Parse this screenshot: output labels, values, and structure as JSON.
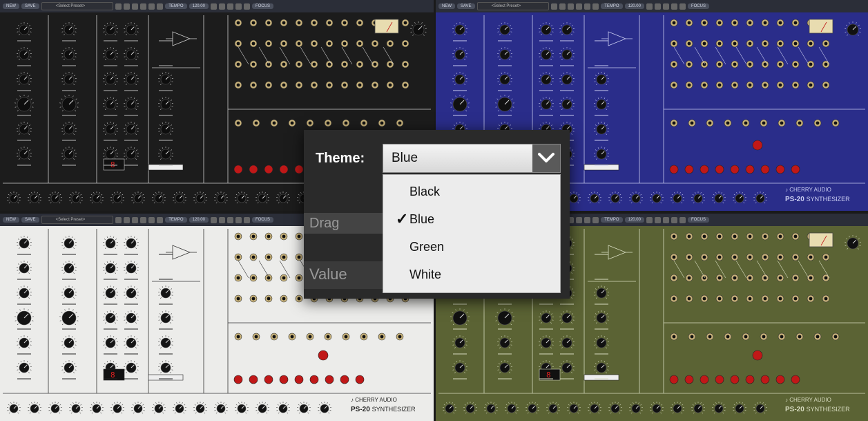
{
  "toolbar": {
    "new_label": "NEW",
    "save_label": "SAVE",
    "preset_placeholder": "<Select Preset>",
    "tempo_label": "TEMPO",
    "tempo_value": "120.00",
    "focus_label": "FOCUS"
  },
  "brand": {
    "company": "CHERRY AUDIO",
    "model": "PS-20",
    "product": "SYNTHESIZER"
  },
  "themes": {
    "black": {
      "panel": "#1c1c1c",
      "line": "#cfcfcf",
      "knob": "#0e0e0e",
      "text": "#bbbbbb"
    },
    "blue": {
      "panel": "#2a2d8a",
      "line": "#c9ccf0",
      "knob": "#111111",
      "text": "#c9ccf0"
    },
    "white": {
      "panel": "#ececea",
      "line": "#333333",
      "knob": "#141414",
      "text": "#222222"
    },
    "green": {
      "panel": "#5b6334",
      "line": "#d8dcc0",
      "knob": "#111111",
      "text": "#d8dcc0"
    }
  },
  "theme_menu": {
    "label": "Theme:",
    "selected": "Blue",
    "options": [
      "Black",
      "Blue",
      "Green",
      "White"
    ],
    "checked_index": 1,
    "behind_text_1": "Drag",
    "behind_text_2": "Value"
  },
  "colors": {
    "accent_red": "#c01818",
    "jack": "#c8b27a"
  }
}
